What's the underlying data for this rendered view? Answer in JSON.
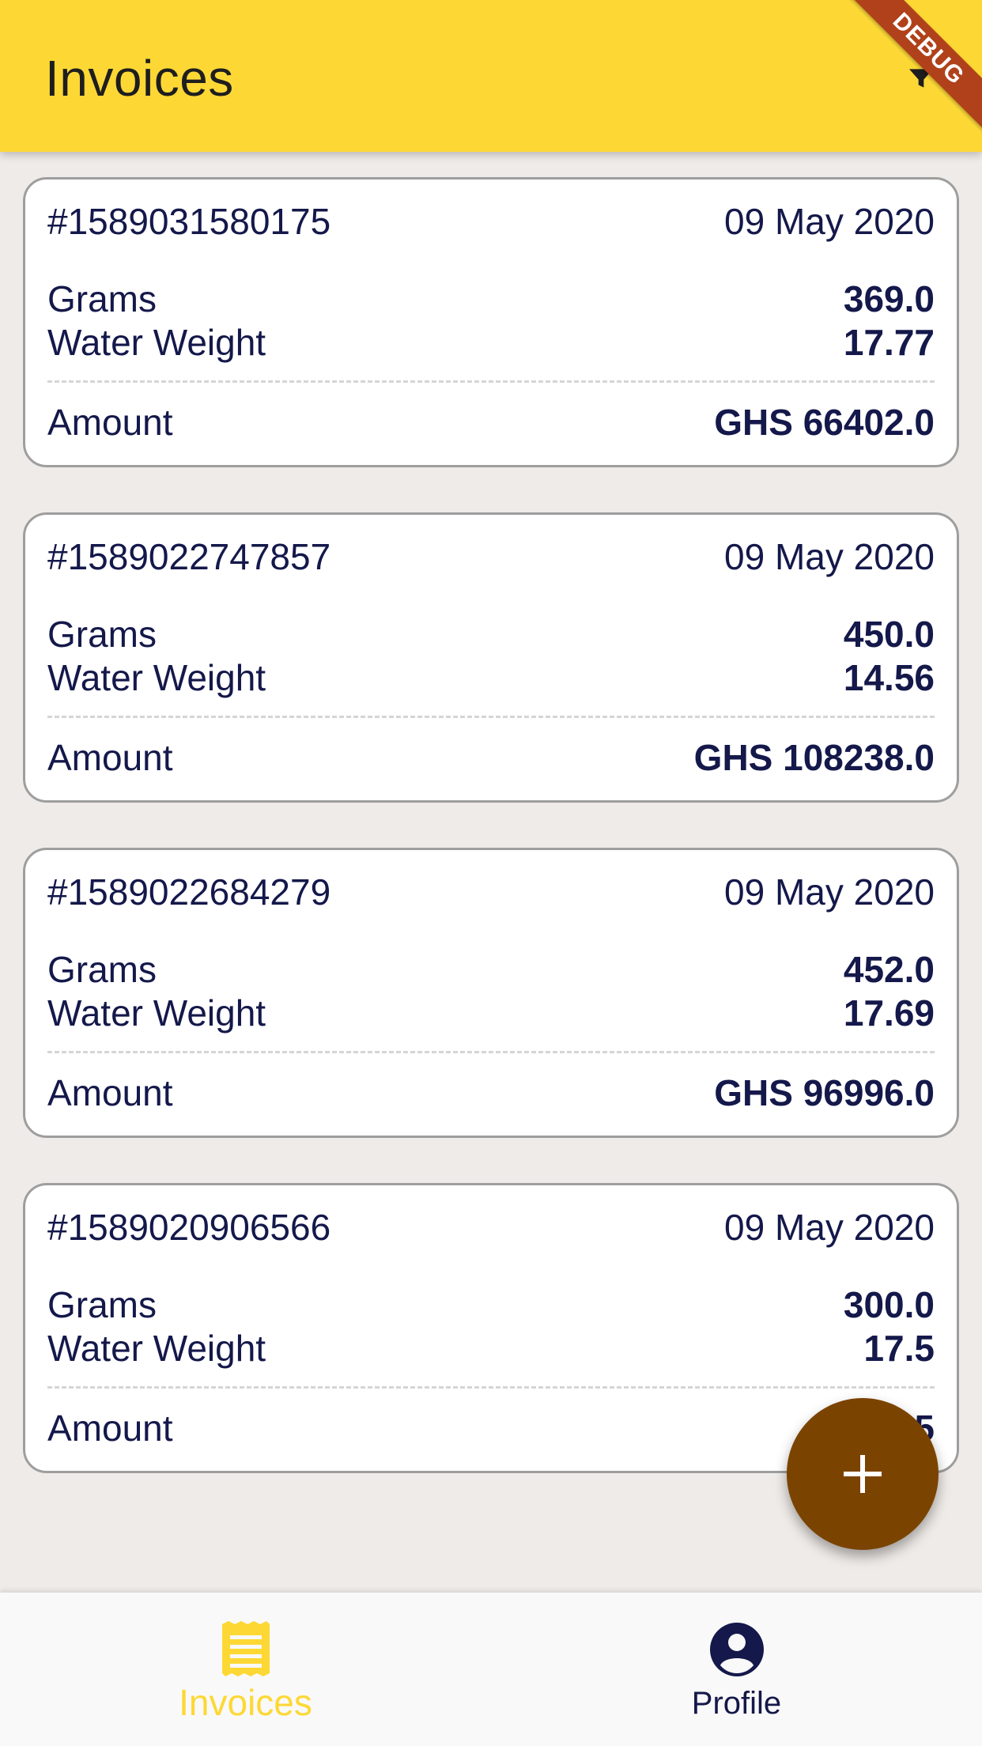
{
  "appbar": {
    "title": "Invoices",
    "debug_banner": "DEBUG"
  },
  "invoices": [
    {
      "id": "#1589031580175",
      "date": "09 May 2020",
      "grams_label": "Grams",
      "grams": "369.0",
      "water_label": "Water Weight",
      "water": "17.77",
      "amount_label": "Amount",
      "amount": "GHS 66402.0"
    },
    {
      "id": "#1589022747857",
      "date": "09 May 2020",
      "grams_label": "Grams",
      "grams": "450.0",
      "water_label": "Water Weight",
      "water": "14.56",
      "amount_label": "Amount",
      "amount": "GHS 108238.0"
    },
    {
      "id": "#1589022684279",
      "date": "09 May 2020",
      "grams_label": "Grams",
      "grams": "452.0",
      "water_label": "Water Weight",
      "water": "17.69",
      "amount_label": "Amount",
      "amount": "GHS 96996.0"
    },
    {
      "id": "#1589020906566",
      "date": "09 May 2020",
      "grams_label": "Grams",
      "grams": "300.0",
      "water_label": "Water Weight",
      "water": "17.5",
      "amount_label": "Amount",
      "amount": "GHS 5"
    }
  ],
  "fab": {
    "icon": "plus-icon"
  },
  "bottom_nav": {
    "items": [
      {
        "label": "Invoices",
        "icon": "receipt-icon",
        "active": true
      },
      {
        "label": "Profile",
        "icon": "account-circle-icon",
        "active": false
      }
    ]
  },
  "colors": {
    "appbar": "#fdd835",
    "background": "#efebe8",
    "text": "#14184a",
    "fab": "#7b4300",
    "nav_active": "#fdd835",
    "debug": "#b0411a"
  }
}
